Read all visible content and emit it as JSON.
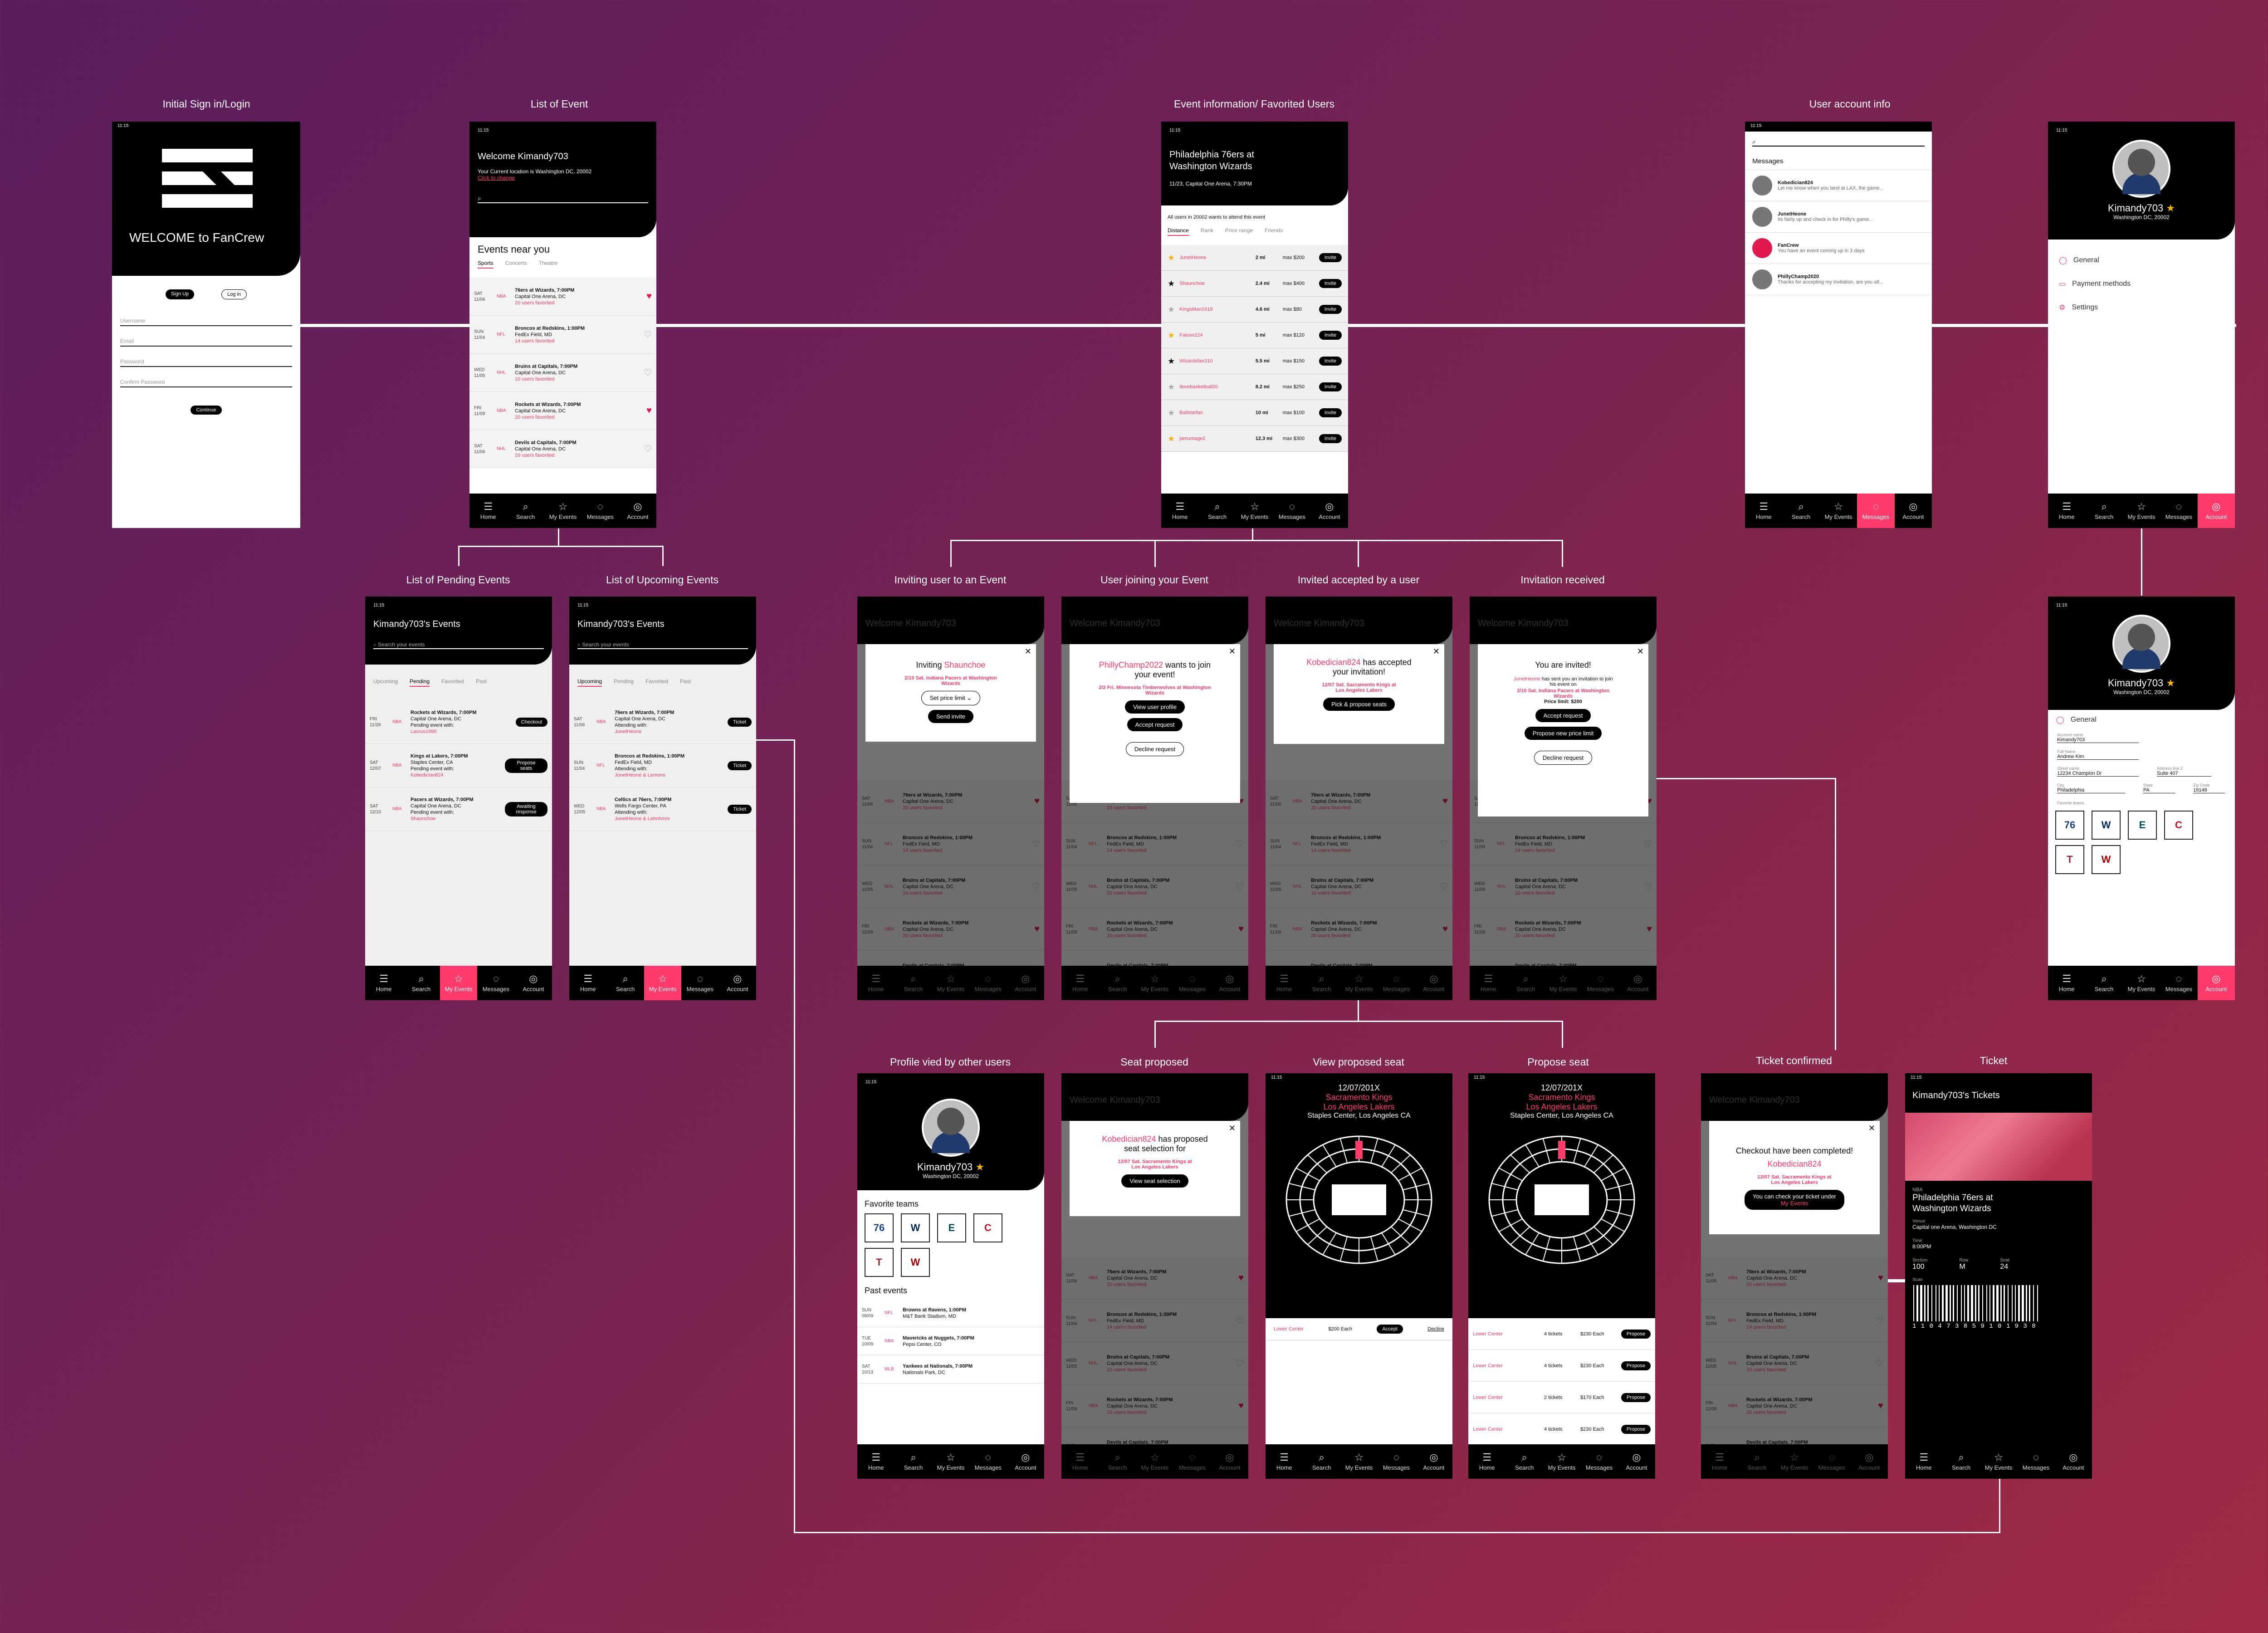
{
  "status_time": "11:15",
  "nav": [
    "Home",
    "Search",
    "My Events",
    "Messages",
    "Account"
  ],
  "labels": {
    "signin": "Initial Sign in/Login",
    "list_event": "List of Event",
    "event_info": "Event information/ Favorited Users",
    "user_account": "User account info",
    "pending": "List of Pending Events",
    "upcoming": "List of Upcoming Events",
    "inviting": "Inviting user to an Event",
    "joining": "User joining your Event",
    "accepted": "Invited accepted by a user",
    "received": "Invitation received",
    "profile_other": "Profile vied by other users",
    "seat_proposed": "Seat proposed",
    "view_seat": "View proposed seat",
    "propose_seat": "Propose seat",
    "ticket_confirmed": "Ticket confirmed",
    "ticket": "Ticket"
  },
  "signin": {
    "welcome": "WELCOME to FanCrew",
    "signup": "Sign Up",
    "login": "Log in",
    "fields": [
      "Username",
      "Email",
      "Password",
      "Confirm Password"
    ],
    "continue": "Continue"
  },
  "list_event": {
    "welcome": "Welcome Kimandy703",
    "location": "Your Current location is Washington DC, 20002",
    "change": "Click to change",
    "near": "Events near you",
    "tabs": [
      "Sports",
      "Concerts",
      "Theatre"
    ],
    "events": [
      {
        "date": "SAT 11/06",
        "cat": "NBA",
        "name": "76ers at Wizards, 7:00PM",
        "venue": "Capital One Arena, DC",
        "fav": "20 users favorited",
        "on": true
      },
      {
        "date": "SUN 11/04",
        "cat": "NFL",
        "name": "Broncos at Redskins, 1:00PM",
        "venue": "FedEx Field, MD",
        "fav": "14 users favorited",
        "on": false
      },
      {
        "date": "WED 11/05",
        "cat": "NHL",
        "name": "Bruins at Capitals, 7:00PM",
        "venue": "Capital One Arena, DC",
        "fav": "10 users favorited",
        "on": false
      },
      {
        "date": "FRI 11/09",
        "cat": "NBA",
        "name": "Rockets at Wizards, 7:00PM",
        "venue": "Capital One Arena, DC",
        "fav": "20 users favorited",
        "on": true
      },
      {
        "date": "SAT 11/06",
        "cat": "NHL",
        "name": "Devils at Capitals, 7:00PM",
        "venue": "Capital One Arena, DC",
        "fav": "20 users favorited",
        "on": false
      }
    ]
  },
  "event_info": {
    "title": "Philadelphia 76ers at Washington Wizards",
    "sub": "11/23, Capital One Arena, 7:30PM",
    "note": "All users in 20002 wants to attend this event",
    "tabs": [
      "Distance",
      "Rank",
      "Price range",
      "Friends"
    ],
    "invite": "Invite",
    "users": [
      {
        "name": "JunetHeone",
        "dist": "2 mi",
        "max": "max $200",
        "star": "gold"
      },
      {
        "name": "Shaunchoe",
        "dist": "2.4 mi",
        "max": "max $400",
        "star": "black"
      },
      {
        "name": "KingsMan1919",
        "dist": "4.6 mi",
        "max": "max $80",
        "star": "grey"
      },
      {
        "name": "Falcon224",
        "dist": "5 mi",
        "max": "max $120",
        "star": "gold"
      },
      {
        "name": "Wizardsfan310",
        "dist": "5.5 mi",
        "max": "max $150",
        "star": "black"
      },
      {
        "name": "Ilovebasketball20",
        "dist": "8.2 mi",
        "max": "max $250",
        "star": "grey"
      },
      {
        "name": "Ballstarfan",
        "dist": "10 mi",
        "max": "max $100",
        "star": "grey"
      },
      {
        "name": "jamumage2",
        "dist": "12.3 mi",
        "max": "max $300",
        "star": "gold"
      }
    ]
  },
  "messages": {
    "title": "Messages",
    "items": [
      {
        "name": "Kobedician824",
        "text": "Let me know when you land at LAX, the game..."
      },
      {
        "name": "JunetHeone",
        "text": "Its fairly up and check in for Philly's game..."
      },
      {
        "name": "FanCrew",
        "text": "You have an event coming up in 3 days"
      },
      {
        "name": "PhillyChamp2020",
        "text": "Thanks for accepting my invitation, are you atl..."
      }
    ]
  },
  "account": {
    "name": "Kimandy703",
    "loc": "Washington DC, 20002",
    "items": [
      "General",
      "Payment methods",
      "Settings"
    ],
    "general": "General",
    "form": [
      {
        "label": "Account name",
        "value": "Kimandy703"
      },
      {
        "label": "Full Name",
        "value": "Andrew Kim"
      }
    ],
    "street": {
      "label": "Street name",
      "value": "12234 Champion Dr"
    },
    "apt": {
      "label": "Address line 2",
      "value": "Suite 407"
    },
    "city": {
      "label": "City",
      "value": "Philadelphia"
    },
    "state": {
      "label": "State",
      "value": "PA"
    },
    "zip": {
      "label": "Zip Code",
      "value": "19148"
    },
    "fav_label": "Favorite teams"
  },
  "my_events": {
    "title": "Kimandy703's Events",
    "search": "Search your events",
    "tabs": [
      "Upcoming",
      "Pending",
      "Favorited",
      "Past"
    ],
    "pending": [
      {
        "date": "FRI 11/28",
        "cat": "NBA",
        "name": "Rockets at Wizards, 7:00PM",
        "venue": "Capital One Arena, DC",
        "status": "Pending event with:",
        "who": "Lacrus1990",
        "btn": "Checkout"
      },
      {
        "date": "SAT 12/07",
        "cat": "NBA",
        "name": "Kings at Lakers, 7:00PM",
        "venue": "Staples Center, CA",
        "status": "Pending event with:",
        "who": "Kobedician824",
        "btn": "Propose seats"
      },
      {
        "date": "SAT 12/10",
        "cat": "NBA",
        "name": "Pacers at Wizards, 7:00PM",
        "venue": "Capital One Arena, DC",
        "status": "Pending event with:",
        "who": "Shaunchoe",
        "btn": "Awaiting response"
      }
    ],
    "upcoming": [
      {
        "date": "SAT 11/06",
        "cat": "NBA",
        "name": "76ers at Wizards, 7:00PM",
        "venue": "Capital One Arena, DC",
        "status": "Attending with:",
        "who": "JunetHeone",
        "btn": "Ticket"
      },
      {
        "date": "SUN 11/04",
        "cat": "NFL",
        "name": "Broncos at Redskins, 1:00PM",
        "venue": "FedEx Field, MD",
        "status": "Attending with:",
        "who": "JunetHeone & Lemons",
        "btn": "Ticket"
      },
      {
        "date": "WED 12/05",
        "cat": "NBA",
        "name": "Celtics at 76ers, 7:00PM",
        "venue": "Wells Fargo Center, PA",
        "status": "Attending with:",
        "who": "JunetHeone & Letmhmrs",
        "btn": "Ticket"
      }
    ]
  },
  "modals": {
    "welcome": "Welcome Kimandy703",
    "inviting": {
      "title": "Inviting",
      "user": "Shaunchoe",
      "event": "2/10 Sat. Indiana Pacers at Washington Wizards",
      "set": "Set price limit",
      "send": "Send invite"
    },
    "joining": {
      "user": "PhillyChamp2022",
      "text": "wants to join your event!",
      "event": "2/2 Fri. Minnesota Timberwolves at Washington Wizards",
      "b1": "View user profile",
      "b2": "Accept request",
      "b3": "Decline request"
    },
    "accepted": {
      "user": "Kobedician824",
      "text": "has accepted your invitation!",
      "event": "12/07 Sat. Sacramento Kings at Los Angeles Lakers",
      "b1": "Pick & propose seats"
    },
    "received": {
      "title": "You are invited!",
      "user": "JunetHeone",
      "text": "has sent you an invitation to join his event on",
      "event": "2/10 Sat. Indiana Pacers at Washington Wizards",
      "price": "Price limit: $200",
      "b1": "Accept request",
      "b2": "Propose new price limit",
      "b3": "Decline request"
    },
    "seat": {
      "user": "Kobedician824",
      "text": "has proposed seat selection for",
      "event": "12/07 Sat. Sacramento Kings at Los Angeles Lakers",
      "b1": "View seat selection"
    },
    "confirmed": {
      "title": "Checkout have been completed!",
      "user": "Kobedician824",
      "event": "12/07 Sat. Sacramento Kings at Los Angeles Lakers",
      "b1": "You can check your ticket under",
      "b1b": "My Events"
    }
  },
  "profile": {
    "fav": "Favorite teams",
    "past": "Past events",
    "events": [
      {
        "date": "SUN 09/09",
        "cat": "NFL",
        "name": "Browns at Ravens, 1:00PM",
        "venue": "M&T Bank Stadium, MD"
      },
      {
        "date": "TUE 10/09",
        "cat": "NBA",
        "name": "Mavericks at Nuggets, 7:00PM",
        "venue": "Pepsi Center, CO"
      },
      {
        "date": "SAT 10/13",
        "cat": "MLB",
        "name": "Yankees at Nationals, 7:00PM",
        "venue": "Nationals Park, DC"
      }
    ]
  },
  "seat_view": {
    "date": "12/07/201X",
    "home": "Sacramento Kings",
    "away": "Los Angeles Lakers",
    "venue": "Staples Center, Los Angeles CA",
    "row_label": "Lower Center",
    "price": "$200 Each",
    "accept": "Accept",
    "decline": "Decline",
    "propose": "Propose",
    "options": [
      {
        "sec": "Lower Center",
        "qty": "4 tickets",
        "price": "$230 Each"
      },
      {
        "sec": "Lower Center",
        "qty": "4 tickets",
        "price": "$230 Each"
      },
      {
        "sec": "Lower Center",
        "qty": "2 tickets",
        "price": "$170 Each"
      },
      {
        "sec": "Lower Center",
        "qty": "4 tickets",
        "price": "$230 Each"
      }
    ]
  },
  "ticket": {
    "title": "Kimandy703's Tickets",
    "league": "NBA",
    "event": "Philadelphia 76ers at Washington Wizards",
    "venue_l": "Venue",
    "venue": "Capital one Arena, Washington DC",
    "time_l": "Time",
    "time": "8:00PM",
    "section_l": "Section",
    "section": "100",
    "row_l": "Row",
    "row": "M",
    "seat_l": "Seat",
    "seat": "24",
    "scan_l": "Scan",
    "barcode_num": "1 1 0 4 7 3 8 5 9 1 0 1 9 3 8"
  }
}
